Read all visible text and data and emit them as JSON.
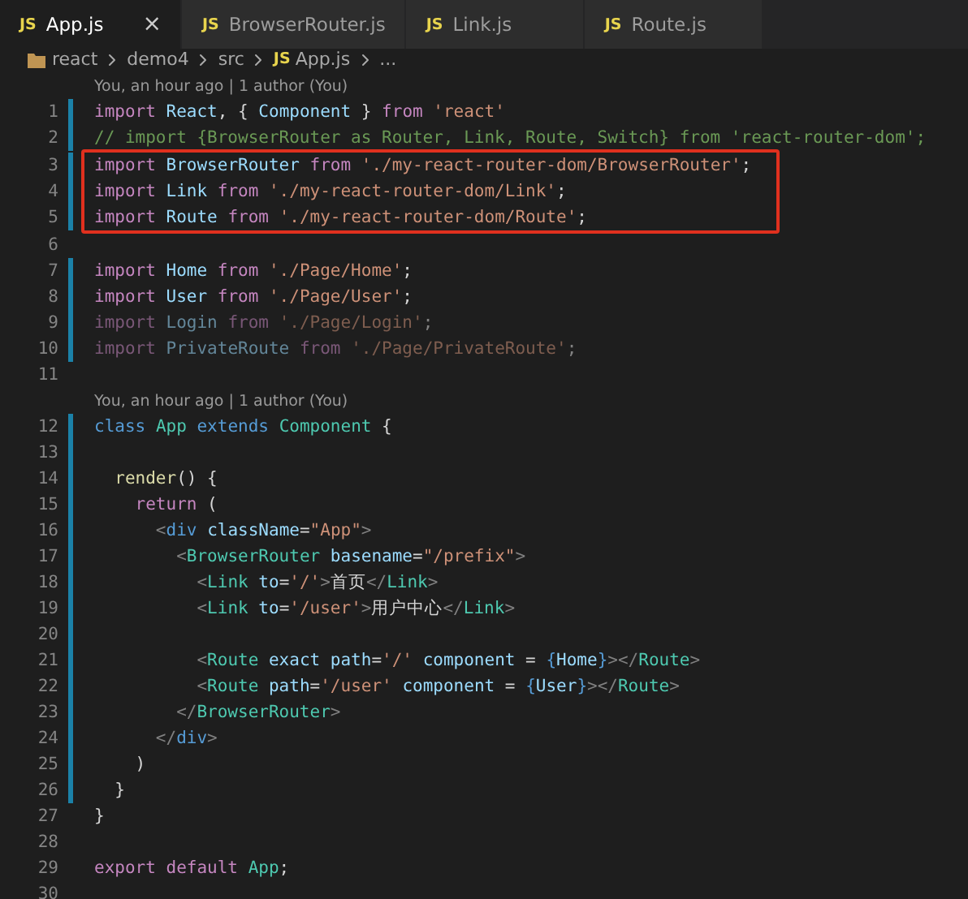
{
  "tabs": [
    {
      "icon_text": "JS",
      "label": "App.js",
      "selected": true,
      "close": "×"
    },
    {
      "icon_text": "JS",
      "label": "BrowserRouter.js",
      "selected": false
    },
    {
      "icon_text": "JS",
      "label": "Link.js",
      "selected": false
    },
    {
      "icon_text": "JS",
      "label": "Route.js",
      "selected": false
    }
  ],
  "breadcrumb": [
    {
      "kind": "folder",
      "label": "react"
    },
    {
      "kind": "folder-plain",
      "label": "demo4"
    },
    {
      "kind": "folder-plain",
      "label": "src"
    },
    {
      "kind": "file",
      "icon_text": "JS",
      "label": "App.js"
    },
    {
      "kind": "more",
      "label": "..."
    }
  ],
  "lines": [
    {
      "kind": "codelens",
      "text": "You, an hour ago | 1 author (You)"
    },
    {
      "kind": "code",
      "number": "1",
      "changed": true,
      "faded": false,
      "boxed": false,
      "tokens": [
        {
          "kind": "keyword",
          "text": "import "
        },
        {
          "kind": "variable",
          "text": "React"
        },
        {
          "kind": "plain",
          "text": ", { "
        },
        {
          "kind": "variable",
          "text": "Component"
        },
        {
          "kind": "plain",
          "text": " } "
        },
        {
          "kind": "keyword",
          "text": "from "
        },
        {
          "kind": "string",
          "text": "'react'"
        }
      ]
    },
    {
      "kind": "code",
      "number": "2",
      "changed": true,
      "faded": false,
      "boxed": false,
      "tokens": [
        {
          "kind": "comment",
          "text": "// import {BrowserRouter as Router, Link, Route, Switch} from 'react-router-dom';"
        }
      ]
    },
    {
      "kind": "code",
      "number": "3",
      "changed": true,
      "faded": false,
      "boxed": true,
      "tokens": [
        {
          "kind": "keyword",
          "text": "import "
        },
        {
          "kind": "variable",
          "text": "BrowserRouter "
        },
        {
          "kind": "keyword",
          "text": "from "
        },
        {
          "kind": "string",
          "text": "'./my-react-router-dom/BrowserRouter'"
        },
        {
          "kind": "plain",
          "text": ";"
        }
      ]
    },
    {
      "kind": "code",
      "number": "4",
      "changed": true,
      "faded": false,
      "boxed": true,
      "tokens": [
        {
          "kind": "keyword",
          "text": "import "
        },
        {
          "kind": "variable",
          "text": "Link "
        },
        {
          "kind": "keyword",
          "text": "from "
        },
        {
          "kind": "string",
          "text": "'./my-react-router-dom/Link'"
        },
        {
          "kind": "plain",
          "text": ";"
        }
      ]
    },
    {
      "kind": "code",
      "number": "5",
      "changed": true,
      "faded": false,
      "boxed": true,
      "tokens": [
        {
          "kind": "keyword",
          "text": "import "
        },
        {
          "kind": "variable",
          "text": "Route "
        },
        {
          "kind": "keyword",
          "text": "from "
        },
        {
          "kind": "string",
          "text": "'./my-react-router-dom/Route'"
        },
        {
          "kind": "plain",
          "text": ";"
        }
      ]
    },
    {
      "kind": "code",
      "number": "6",
      "changed": false
    },
    {
      "kind": "code",
      "number": "7",
      "changed": true,
      "faded": false,
      "boxed": false,
      "tokens": [
        {
          "kind": "keyword",
          "text": "import "
        },
        {
          "kind": "variable",
          "text": "Home "
        },
        {
          "kind": "keyword",
          "text": "from "
        },
        {
          "kind": "string",
          "text": "'./Page/Home'"
        },
        {
          "kind": "plain",
          "text": ";"
        }
      ]
    },
    {
      "kind": "code",
      "number": "8",
      "changed": true,
      "faded": false,
      "boxed": false,
      "tokens": [
        {
          "kind": "keyword",
          "text": "import "
        },
        {
          "kind": "variable",
          "text": "User "
        },
        {
          "kind": "keyword",
          "text": "from "
        },
        {
          "kind": "string",
          "text": "'./Page/User'"
        },
        {
          "kind": "plain",
          "text": ";"
        }
      ]
    },
    {
      "kind": "code",
      "number": "9",
      "changed": true,
      "faded": true,
      "boxed": false,
      "tokens": [
        {
          "kind": "keyword",
          "text": "import "
        },
        {
          "kind": "variable",
          "text": "Login "
        },
        {
          "kind": "keyword",
          "text": "from "
        },
        {
          "kind": "string",
          "text": "'./Page/Login'"
        },
        {
          "kind": "plain",
          "text": ";"
        }
      ]
    },
    {
      "kind": "code",
      "number": "10",
      "changed": true,
      "faded": true,
      "boxed": false,
      "tokens": [
        {
          "kind": "keyword",
          "text": "import "
        },
        {
          "kind": "variable",
          "text": "PrivateRoute "
        },
        {
          "kind": "keyword",
          "text": "from "
        },
        {
          "kind": "string",
          "text": "'./Page/PrivateRoute'"
        },
        {
          "kind": "plain",
          "text": ";"
        }
      ]
    },
    {
      "kind": "code",
      "number": "11",
      "changed": false
    },
    {
      "kind": "codelens",
      "text": "You, an hour ago | 1 author (You)"
    },
    {
      "kind": "code",
      "number": "12",
      "changed": true,
      "faded": false,
      "boxed": false,
      "tokens": [
        {
          "kind": "storage",
          "text": "class "
        },
        {
          "kind": "type",
          "text": "App "
        },
        {
          "kind": "storage",
          "text": "extends "
        },
        {
          "kind": "type",
          "text": "Component "
        },
        {
          "kind": "plain",
          "text": "{"
        }
      ]
    },
    {
      "kind": "code",
      "number": "13",
      "changed": true
    },
    {
      "kind": "code",
      "number": "14",
      "changed": true,
      "faded": false,
      "boxed": false,
      "tokens": [
        {
          "kind": "function",
          "text": "  render"
        },
        {
          "kind": "plain",
          "text": "() {"
        }
      ]
    },
    {
      "kind": "code",
      "number": "15",
      "changed": true,
      "faded": false,
      "boxed": false,
      "tokens": [
        {
          "kind": "keyword",
          "text": "    return "
        },
        {
          "kind": "plain",
          "text": "("
        }
      ]
    },
    {
      "kind": "code",
      "number": "16",
      "changed": true,
      "faded": false,
      "boxed": false,
      "tokens": [
        {
          "kind": "punctuation",
          "text": "      <"
        },
        {
          "kind": "storage",
          "text": "div "
        },
        {
          "kind": "attribute",
          "text": "className"
        },
        {
          "kind": "plain",
          "text": "="
        },
        {
          "kind": "string",
          "text": "\"App\""
        },
        {
          "kind": "punctuation",
          "text": ">"
        }
      ]
    },
    {
      "kind": "code",
      "number": "17",
      "changed": true,
      "faded": false,
      "boxed": false,
      "tokens": [
        {
          "kind": "punctuation",
          "text": "        <"
        },
        {
          "kind": "type",
          "text": "BrowserRouter "
        },
        {
          "kind": "attribute",
          "text": "basename"
        },
        {
          "kind": "plain",
          "text": "="
        },
        {
          "kind": "string",
          "text": "\"/prefix\""
        },
        {
          "kind": "punctuation",
          "text": ">"
        }
      ]
    },
    {
      "kind": "code",
      "number": "18",
      "changed": true,
      "faded": false,
      "boxed": false,
      "tokens": [
        {
          "kind": "punctuation",
          "text": "          <"
        },
        {
          "kind": "type",
          "text": "Link "
        },
        {
          "kind": "attribute",
          "text": "to"
        },
        {
          "kind": "plain",
          "text": "="
        },
        {
          "kind": "string",
          "text": "'/'"
        },
        {
          "kind": "punctuation",
          "text": ">"
        },
        {
          "kind": "plain",
          "text": "首页"
        },
        {
          "kind": "punctuation",
          "text": "</"
        },
        {
          "kind": "type",
          "text": "Link"
        },
        {
          "kind": "punctuation",
          "text": ">"
        }
      ]
    },
    {
      "kind": "code",
      "number": "19",
      "changed": true,
      "faded": false,
      "boxed": false,
      "tokens": [
        {
          "kind": "punctuation",
          "text": "          <"
        },
        {
          "kind": "type",
          "text": "Link "
        },
        {
          "kind": "attribute",
          "text": "to"
        },
        {
          "kind": "plain",
          "text": "="
        },
        {
          "kind": "string",
          "text": "'/user'"
        },
        {
          "kind": "punctuation",
          "text": ">"
        },
        {
          "kind": "plain",
          "text": "用户中心"
        },
        {
          "kind": "punctuation",
          "text": "</"
        },
        {
          "kind": "type",
          "text": "Link"
        },
        {
          "kind": "punctuation",
          "text": ">"
        }
      ]
    },
    {
      "kind": "code",
      "number": "20",
      "changed": true
    },
    {
      "kind": "code",
      "number": "21",
      "changed": true,
      "faded": false,
      "boxed": false,
      "tokens": [
        {
          "kind": "punctuation",
          "text": "          <"
        },
        {
          "kind": "type",
          "text": "Route "
        },
        {
          "kind": "attribute",
          "text": "exact path"
        },
        {
          "kind": "plain",
          "text": "="
        },
        {
          "kind": "string",
          "text": "'/' "
        },
        {
          "kind": "attribute",
          "text": "component "
        },
        {
          "kind": "plain",
          "text": "= "
        },
        {
          "kind": "brace",
          "text": "{"
        },
        {
          "kind": "variable",
          "text": "Home"
        },
        {
          "kind": "brace",
          "text": "}"
        },
        {
          "kind": "punctuation",
          "text": "></"
        },
        {
          "kind": "type",
          "text": "Route"
        },
        {
          "kind": "punctuation",
          "text": ">"
        }
      ]
    },
    {
      "kind": "code",
      "number": "22",
      "changed": true,
      "faded": false,
      "boxed": false,
      "tokens": [
        {
          "kind": "punctuation",
          "text": "          <"
        },
        {
          "kind": "type",
          "text": "Route "
        },
        {
          "kind": "attribute",
          "text": "path"
        },
        {
          "kind": "plain",
          "text": "="
        },
        {
          "kind": "string",
          "text": "'/user' "
        },
        {
          "kind": "attribute",
          "text": "component "
        },
        {
          "kind": "plain",
          "text": "= "
        },
        {
          "kind": "brace",
          "text": "{"
        },
        {
          "kind": "variable",
          "text": "User"
        },
        {
          "kind": "brace",
          "text": "}"
        },
        {
          "kind": "punctuation",
          "text": "></"
        },
        {
          "kind": "type",
          "text": "Route"
        },
        {
          "kind": "punctuation",
          "text": ">"
        }
      ]
    },
    {
      "kind": "code",
      "number": "23",
      "changed": true,
      "faded": false,
      "boxed": false,
      "tokens": [
        {
          "kind": "punctuation",
          "text": "        </"
        },
        {
          "kind": "type",
          "text": "BrowserRouter"
        },
        {
          "kind": "punctuation",
          "text": ">"
        }
      ]
    },
    {
      "kind": "code",
      "number": "24",
      "changed": true,
      "faded": false,
      "boxed": false,
      "tokens": [
        {
          "kind": "punctuation",
          "text": "      </"
        },
        {
          "kind": "storage",
          "text": "div"
        },
        {
          "kind": "punctuation",
          "text": ">"
        }
      ]
    },
    {
      "kind": "code",
      "number": "25",
      "changed": true,
      "faded": false,
      "boxed": false,
      "tokens": [
        {
          "kind": "plain",
          "text": "    )"
        }
      ]
    },
    {
      "kind": "code",
      "number": "26",
      "changed": true,
      "faded": false,
      "boxed": false,
      "tokens": [
        {
          "kind": "plain",
          "text": "  }"
        }
      ]
    },
    {
      "kind": "code",
      "number": "27",
      "changed": false,
      "faded": false,
      "boxed": false,
      "tokens": [
        {
          "kind": "plain",
          "text": "}"
        }
      ]
    },
    {
      "kind": "code",
      "number": "28",
      "changed": false
    },
    {
      "kind": "code",
      "number": "29",
      "changed": false,
      "faded": false,
      "boxed": false,
      "tokens": [
        {
          "kind": "keyword",
          "text": "export default "
        },
        {
          "kind": "type",
          "text": "App"
        },
        {
          "kind": "plain",
          "text": ";"
        }
      ]
    },
    {
      "kind": "code",
      "number": "30",
      "changed": false
    }
  ]
}
